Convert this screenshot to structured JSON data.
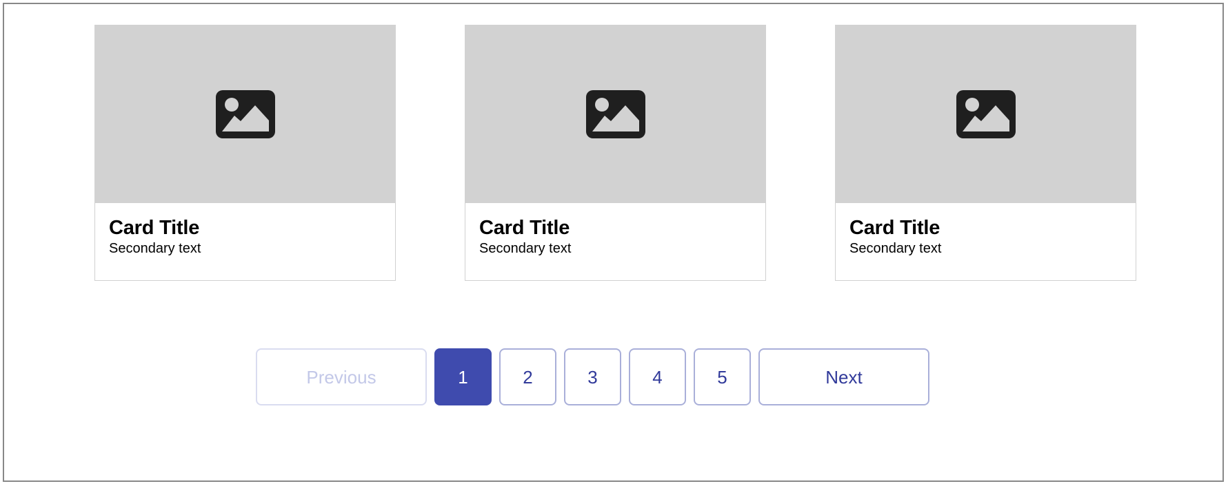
{
  "cards": [
    {
      "media_icon": "image-placeholder-icon",
      "title": "Card Title",
      "secondary": "Secondary text"
    },
    {
      "media_icon": "image-placeholder-icon",
      "title": "Card Title",
      "secondary": "Secondary text"
    },
    {
      "media_icon": "image-placeholder-icon",
      "title": "Card Title",
      "secondary": "Secondary text"
    }
  ],
  "pagination": {
    "previous_label": "Previous",
    "next_label": "Next",
    "pages": [
      "1",
      "2",
      "3",
      "4",
      "5"
    ],
    "active_page": "1",
    "previous_disabled": true,
    "next_disabled": false
  },
  "colors": {
    "accent": "#3f4bae",
    "accent_text": "#313a9a",
    "border_lavender": "#a9afd9",
    "border_disabled": "#d9dcf0",
    "text_disabled": "#c3c8e8",
    "media_placeholder": "#d2d2d2",
    "card_border": "#d0d0d0",
    "frame_border": "#888888"
  }
}
